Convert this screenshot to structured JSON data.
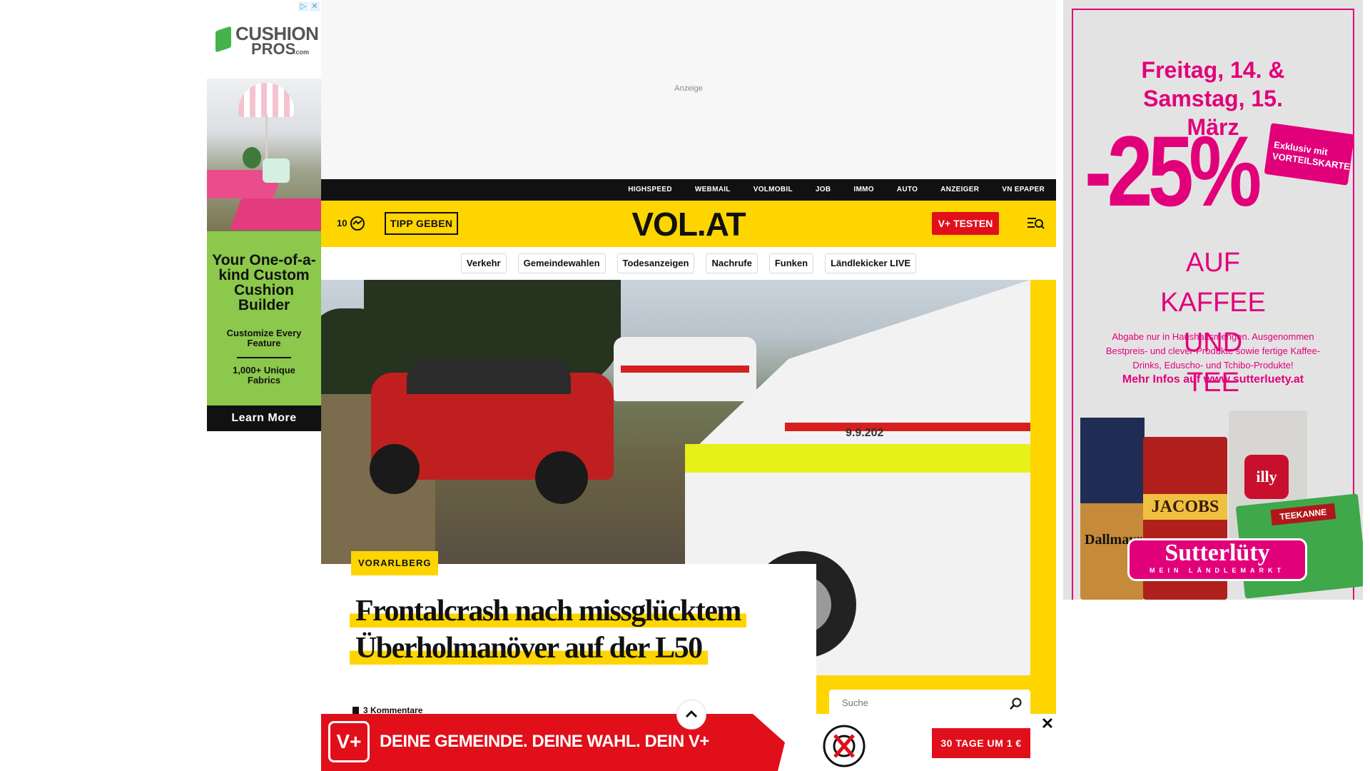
{
  "left_ad": {
    "brand_line1": "CUSHION",
    "brand_line2": "PROS",
    "brand_suffix": ".com",
    "headline": "Your One-of-a-kind Custom Cushion Builder",
    "feature1": "Customize Every Feature",
    "feature2": "1,000+ Unique Fabrics",
    "cta": "Learn More",
    "accent": "#8cc84b"
  },
  "top_ad": {
    "label": "Anzeige"
  },
  "service_nav": [
    "HIGHSPEED",
    "WEBMAIL",
    "VOLMOBIL",
    "JOB",
    "IMMO",
    "AUTO",
    "ANZEIGER",
    "VN EPAPER"
  ],
  "header": {
    "temperature": "10",
    "weather_icon": "weather-icon",
    "tip_button": "TIPP GEBEN",
    "logo": "VOL.AT",
    "vplus_button": "V+ TESTEN",
    "menu_icon": "menu-search-icon",
    "brand_color": "#ffd500",
    "red": "#e10f1a"
  },
  "topic_nav": [
    "Verkehr",
    "Gemeindewahlen",
    "Todesanzeigen",
    "Nachrufe",
    "Funken",
    "Ländlekicker LIVE"
  ],
  "hero": {
    "van_number": "9.9.202"
  },
  "article": {
    "category": "VORARLBERG",
    "headline": "Frontalcrash nach missglücktem Überholmanöver auf der L50",
    "comments": "3 Kommentare"
  },
  "search": {
    "placeholder": "Suche"
  },
  "bottom_ad": {
    "logo": "V+",
    "slogan": "DEINE GEMEINDE. DEINE WAHL. DEIN V+",
    "cta": "30 TAGE UM 1 €",
    "close": "✕"
  },
  "right_ad": {
    "date": "Freitag, 14. & Samstag, 15. März",
    "discount": "-25%",
    "badge": "Exklusiv mit VORTEILSKARTE",
    "product": "AUF KAFFEE UND TEE",
    "note": "Abgabe nur in Haushaltsmengen. Ausgenommen Bestpreis- und clever-Produkte sowie fertige Kaffee-Drinks, Eduscho- und Tchibo-Produkte!",
    "link": "Mehr Infos auf www.sutterluety.at",
    "pack1": "Dallmayr",
    "pack2": "JACOBS",
    "pack3": "illy",
    "pack4": "TEEKANNE",
    "brand": "Sutterlüty",
    "brand_sub": "MEIN LÄNDLEMARKT",
    "accent": "#e2007a"
  }
}
